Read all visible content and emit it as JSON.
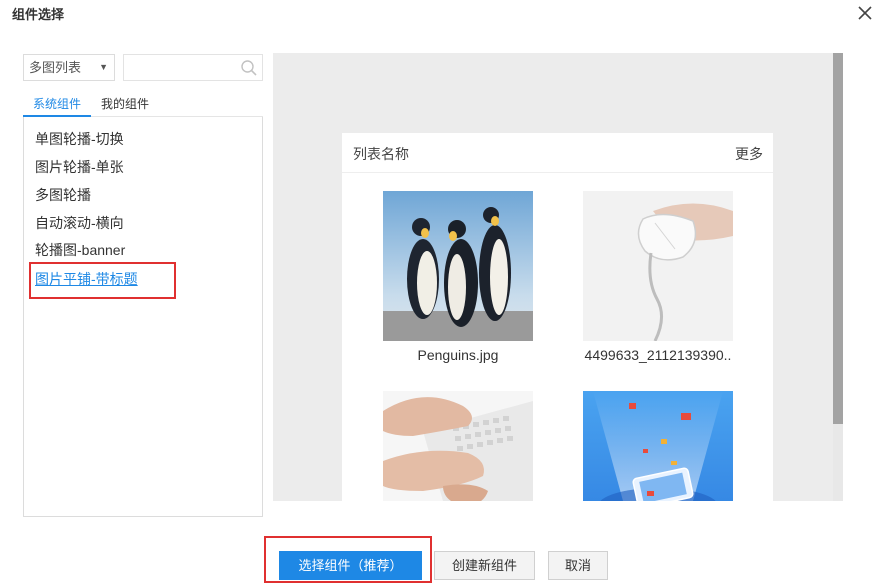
{
  "dialog": {
    "title": "组件选择"
  },
  "left": {
    "type_select": {
      "value": "多图列表"
    },
    "search": {
      "placeholder": "",
      "value": ""
    },
    "tabs": [
      {
        "label": "系统组件",
        "active": true
      },
      {
        "label": "我的组件",
        "active": false
      }
    ],
    "items": [
      {
        "label": "单图轮播-切换"
      },
      {
        "label": "图片轮播-单张"
      },
      {
        "label": "多图轮播"
      },
      {
        "label": "自动滚动-横向"
      },
      {
        "label": "轮播图-banner"
      },
      {
        "label": "图片平铺-带标题",
        "selected": true
      }
    ]
  },
  "preview": {
    "card_title": "列表名称",
    "more_label": "更多",
    "images": [
      {
        "caption": "Penguins.jpg",
        "icon": "penguins-image"
      },
      {
        "caption": "4499633_2112139390..",
        "icon": "mouse-image"
      },
      {
        "caption": "",
        "icon": "keyboard-typing-image"
      },
      {
        "caption": "",
        "icon": "phone-envelopes-image"
      }
    ]
  },
  "footer": {
    "select_button": "选择组件（推荐）",
    "create_button": "创建新组件",
    "cancel_button": "取消"
  },
  "colors": {
    "accent": "#1e88e5",
    "highlight": "#e03030"
  }
}
